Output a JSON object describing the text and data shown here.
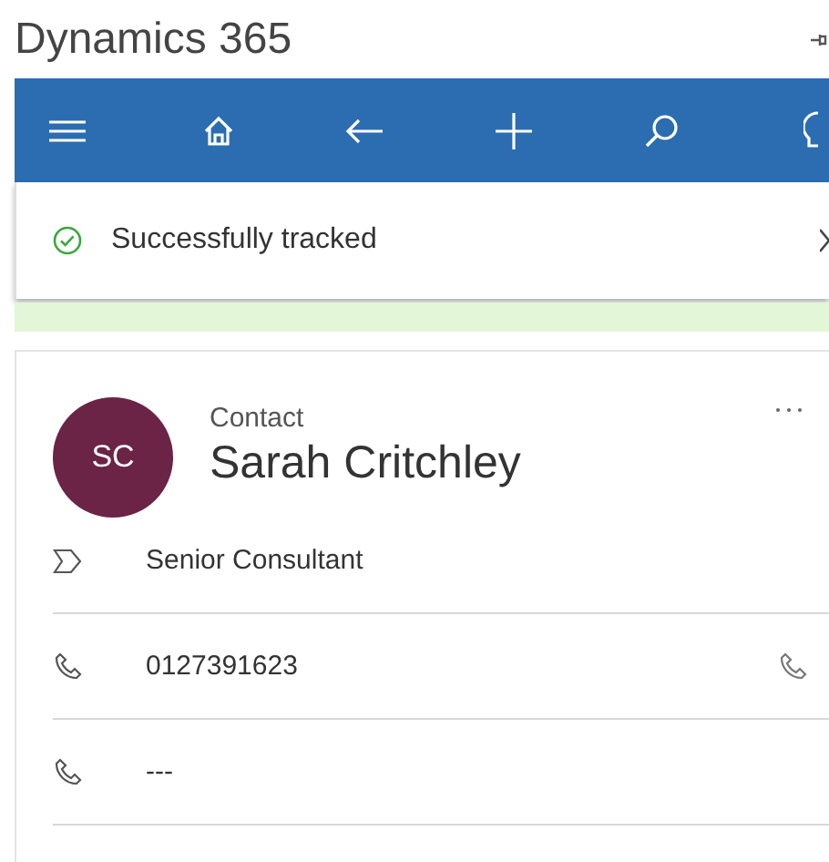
{
  "app": {
    "title": "Dynamics 365"
  },
  "notification": {
    "message": "Successfully tracked"
  },
  "record": {
    "initials": "SC",
    "type": "Contact",
    "name": "Sarah Critchley",
    "fields": [
      {
        "kind": "job",
        "value": "Senior Consultant",
        "action": false
      },
      {
        "kind": "phone",
        "value": "0127391623",
        "action": true
      },
      {
        "kind": "phone",
        "value": "---",
        "action": false
      }
    ]
  }
}
